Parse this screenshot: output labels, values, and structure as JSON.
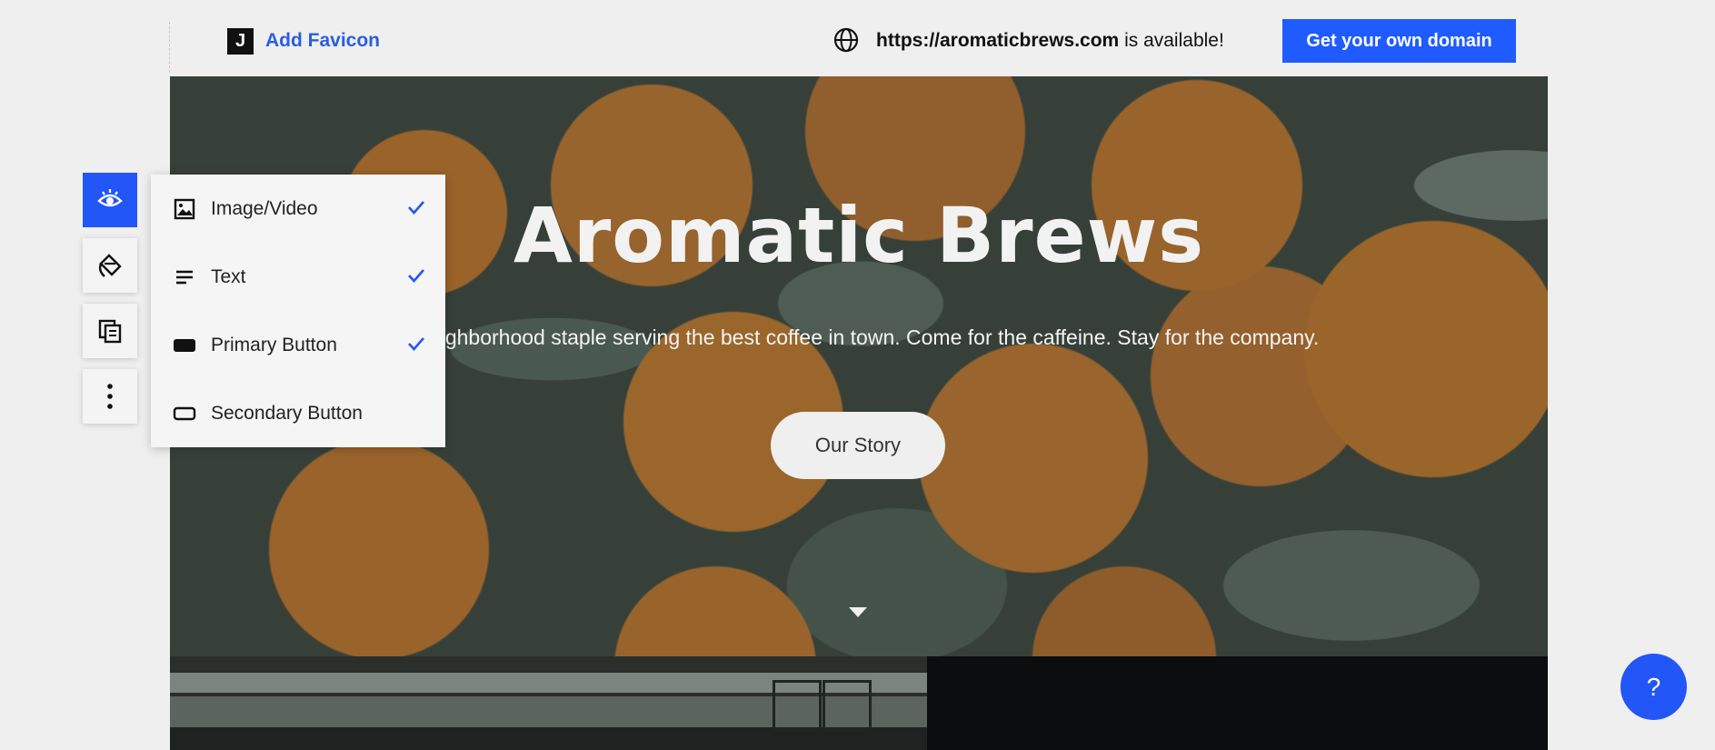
{
  "topbar": {
    "favicon_letter": "J",
    "add_favicon_label": "Add Favicon",
    "domain_url": "https://aromaticbrews.com",
    "domain_status": " is available!",
    "get_domain_label": "Get your own domain"
  },
  "hero": {
    "title": "Aromatic Brews",
    "subtitle": "A neighborhood staple serving the best coffee in town. Come for the caffeine. Stay for the company.",
    "button_label": "Our Story"
  },
  "tools": [
    "eye-icon",
    "paint-bucket-icon",
    "copy-icon",
    "more-vertical-icon"
  ],
  "visibility_menu": {
    "items": [
      {
        "label": "Image/Video",
        "icon": "image-icon",
        "checked": true
      },
      {
        "label": "Text",
        "icon": "text-lines-icon",
        "checked": true
      },
      {
        "label": "Primary Button",
        "icon": "filled-button-icon",
        "checked": true
      },
      {
        "label": "Secondary Button",
        "icon": "outline-button-icon",
        "checked": false
      }
    ]
  },
  "help_label": "?",
  "colors": {
    "accent": "#2356f6",
    "link": "#2b5de2",
    "background": "#efefef"
  }
}
